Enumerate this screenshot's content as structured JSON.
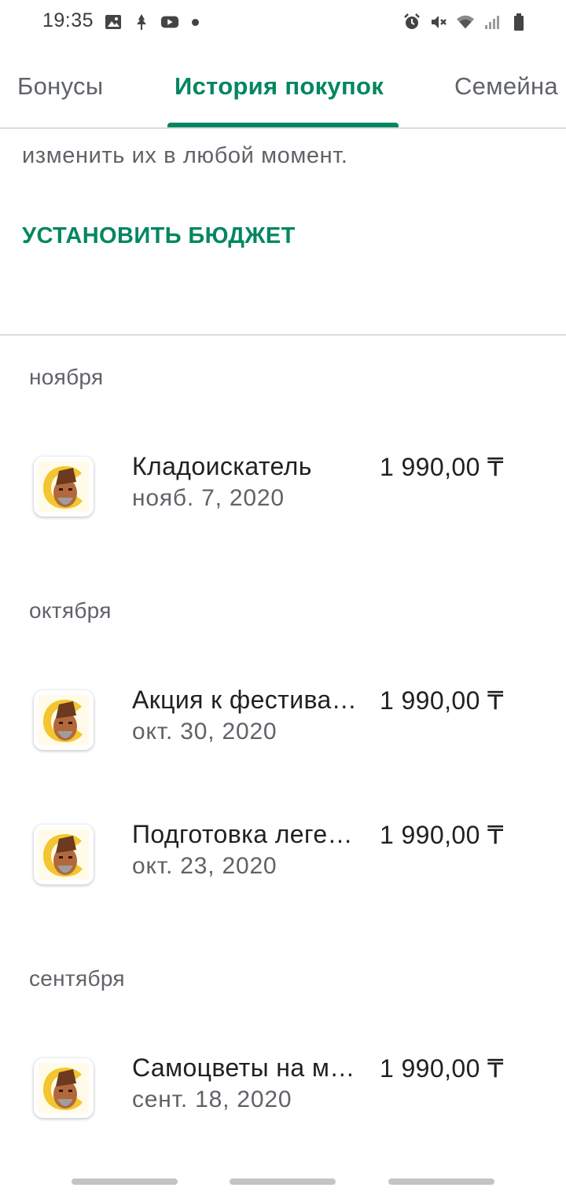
{
  "status_bar": {
    "time": "19:35",
    "left_icons": [
      "gallery-icon",
      "app-notification-icon",
      "youtube-icon",
      "dot-icon"
    ],
    "right_icons": [
      "alarm-icon",
      "mute-icon",
      "wifi-icon",
      "signal-icon",
      "battery-icon"
    ]
  },
  "tabs": [
    {
      "label": "Бонусы",
      "active": false
    },
    {
      "label": "История покупок",
      "active": true
    },
    {
      "label": "Семейна",
      "active": false
    }
  ],
  "budget": {
    "description": "изменить их в любой момент.",
    "button_label": "УСТАНОВИТЬ БЮДЖЕТ"
  },
  "groups": [
    {
      "month": "ноября",
      "items": [
        {
          "title": "Кладоискатель",
          "date": "нояб. 7, 2020",
          "price": "1 990,00 ₸"
        }
      ]
    },
    {
      "month": "октября",
      "items": [
        {
          "title": "Акция к фестива…",
          "date": "окт. 30, 2020",
          "price": "1 990,00 ₸"
        },
        {
          "title": "Подготовка леге…",
          "date": "окт. 23, 2020",
          "price": "1 990,00 ₸"
        }
      ]
    },
    {
      "month": "сентября",
      "items": [
        {
          "title": "Самоцветы на м…",
          "date": "сент. 18, 2020",
          "price": "1 990,00 ₸"
        }
      ]
    }
  ],
  "colors": {
    "accent": "#01875f",
    "text_primary": "#202124",
    "text_secondary": "#5f6368",
    "divider": "#dadce0"
  }
}
